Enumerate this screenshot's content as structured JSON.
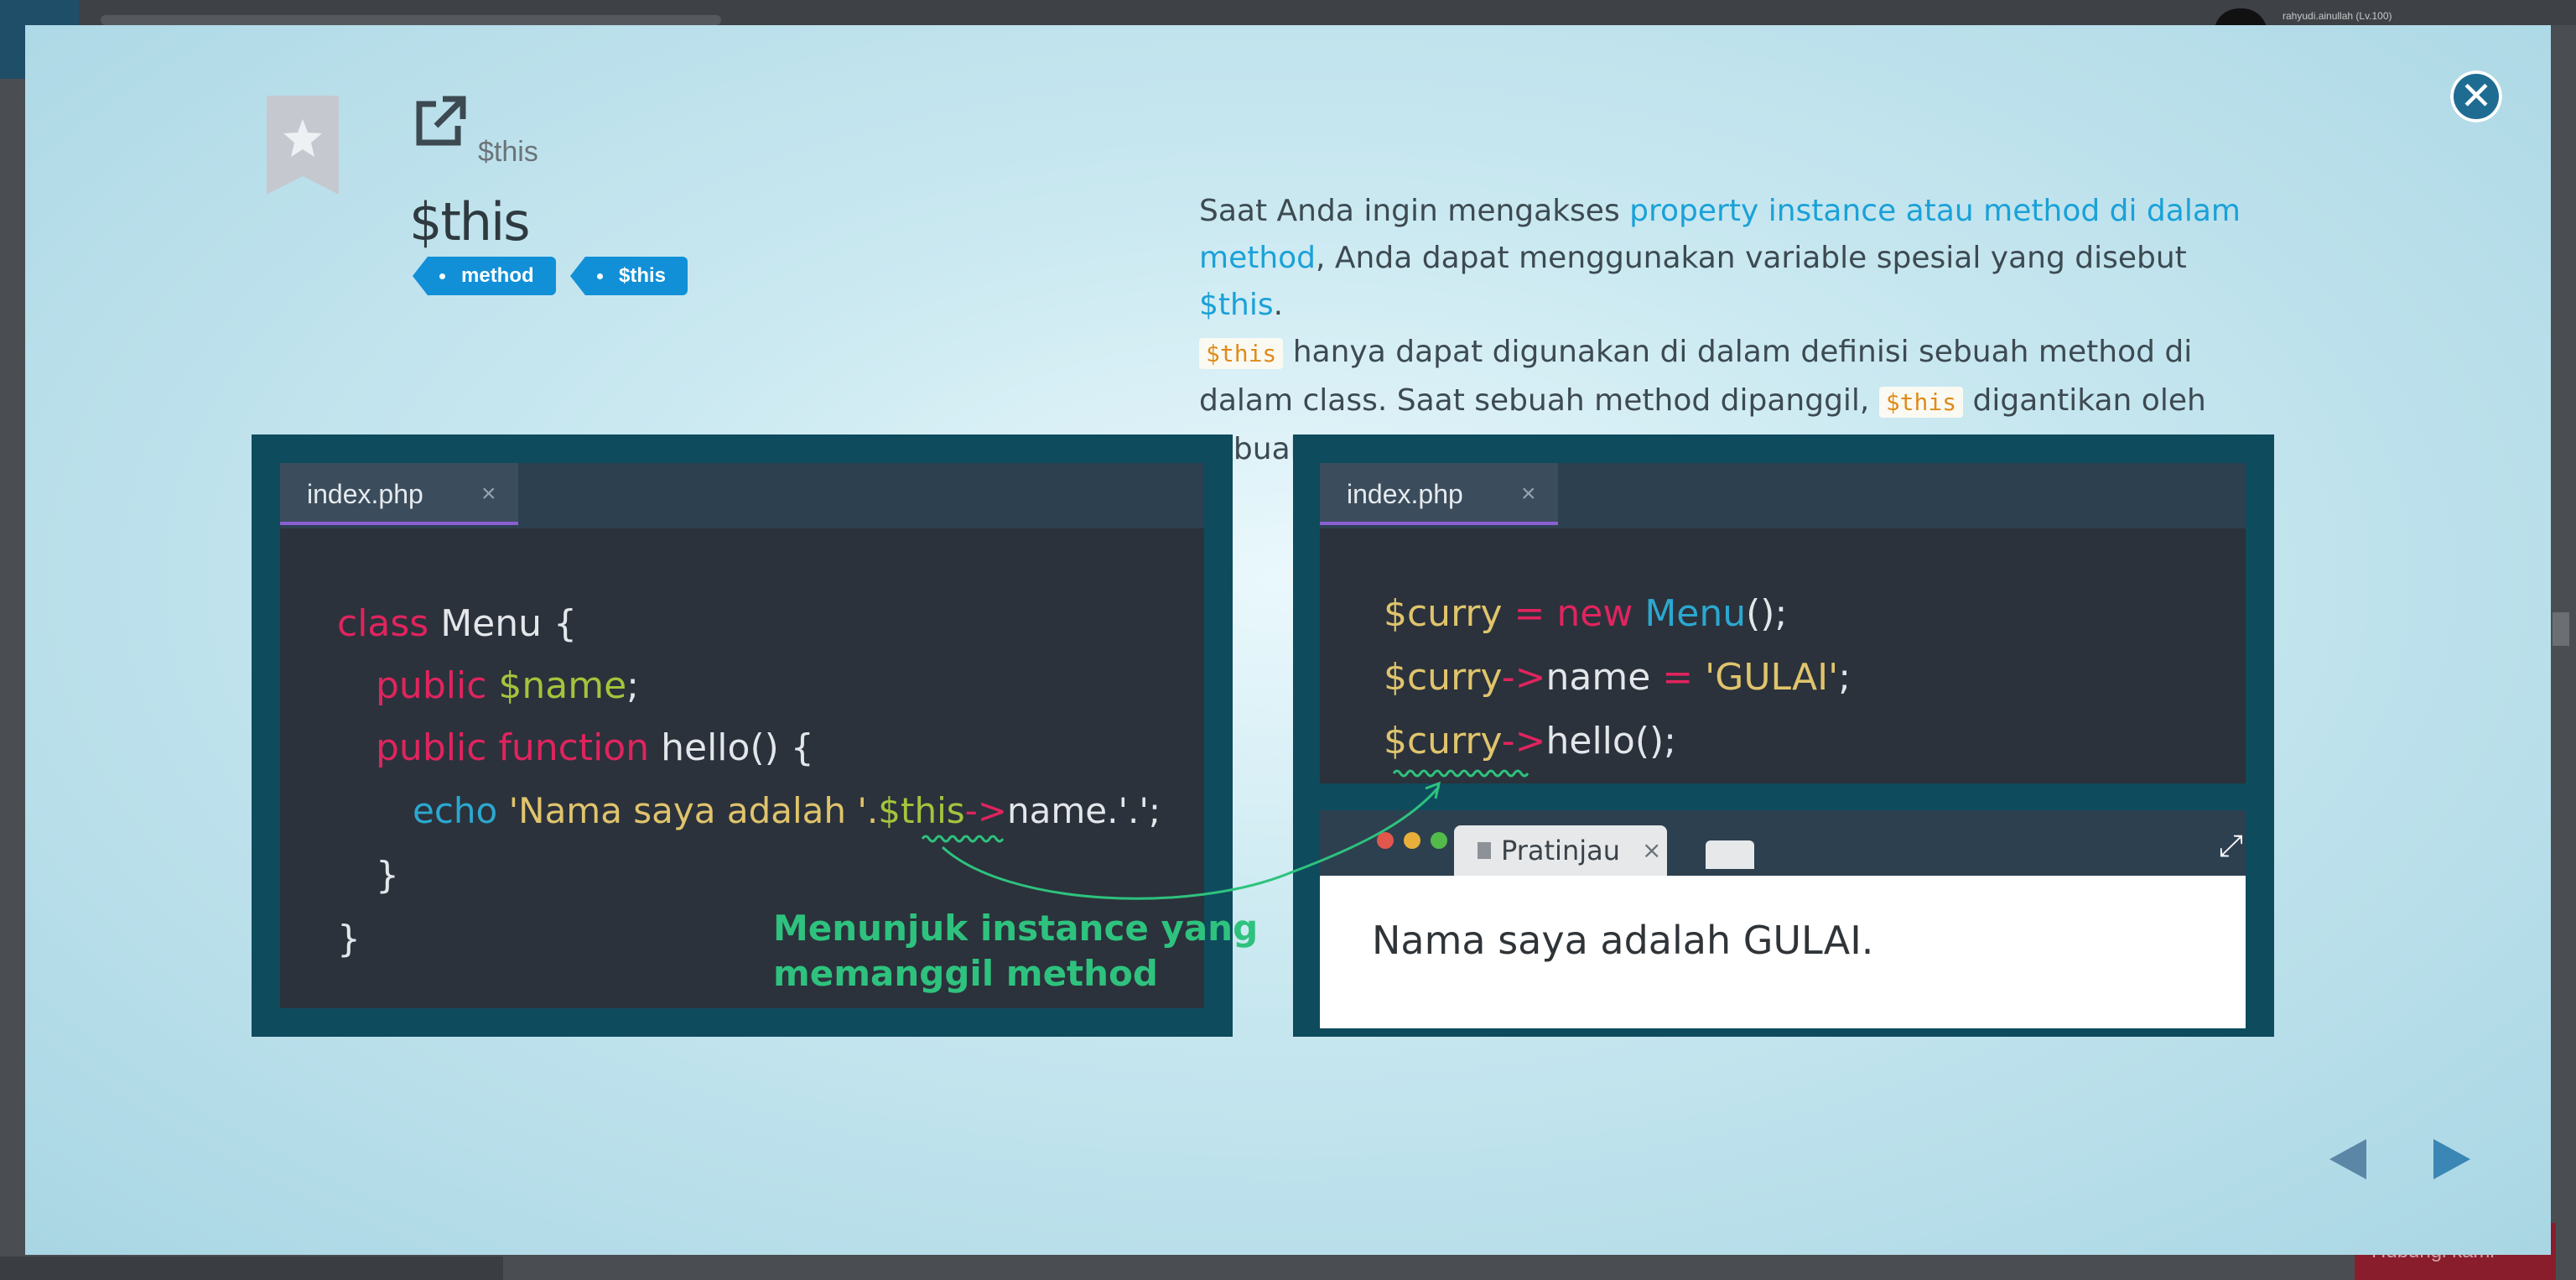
{
  "background": {
    "user_label": "rahyudi.ainullah (Lv.100)",
    "bottom_button": "Hubungi kami"
  },
  "modal": {
    "breadcrumb": "$this",
    "title": "$this",
    "tags": [
      "method",
      "$this"
    ],
    "description": {
      "p1": "Saat Anda ingin mengakses ",
      "link": "property instance atau method di dalam method",
      "p2": ", Anda dapat menggunakan variable spesial yang disebut ",
      "this_inline": "$this",
      "p3": ".",
      "code1": "$this",
      "p4": " hanya dapat digunakan di dalam definisi sebuah method di dalam class. Saat sebuah method dipanggil, ",
      "code2": "$this",
      "p5": " digantikan oleh sebuah instance yang memanggil method."
    },
    "left_editor": {
      "tab": "index.php",
      "tab_close": "×",
      "lines": {
        "l1_kw": "class",
        "l1_rest": " Menu {",
        "l2_kw": "public",
        "l2_var": " $name",
        "l2_rest": ";",
        "l3_kw": "public function",
        "l3_rest": " hello() {",
        "l4_fn": "echo",
        "l4_str1": " 'Nama saya adalah '",
        "l4_dot": ".",
        "l4_var": "$this",
        "l4_op": "->",
        "l4_rest": "name.'.';",
        "l5": "}",
        "l6": "}"
      },
      "annotation_l1": "Menunjuk instance yang",
      "annotation_l2": "memanggil method"
    },
    "right_editor": {
      "tab": "index.php",
      "tab_close": "×",
      "lines": {
        "l1_var": "$curry",
        "l1_op": " = ",
        "l1_kw": "new",
        "l1_fn": " Menu",
        "l1_rest": "();",
        "l2_var": "$curry",
        "l2_op": "->",
        "l2_name": "name",
        "l2_eq": " = ",
        "l2_str": "'GULAI'",
        "l2_rest": ";",
        "l3_var": "$curry",
        "l3_op": "->",
        "l3_rest": "hello();"
      }
    },
    "preview": {
      "tab_label": "Pratinjau",
      "tab_close": "×",
      "output": "Nama saya adalah GULAI."
    },
    "colors": {
      "accent": "#1aa1d8",
      "panel": "#0e4b5d",
      "tag": "#1190d8",
      "annotation": "#2ec27e"
    }
  }
}
